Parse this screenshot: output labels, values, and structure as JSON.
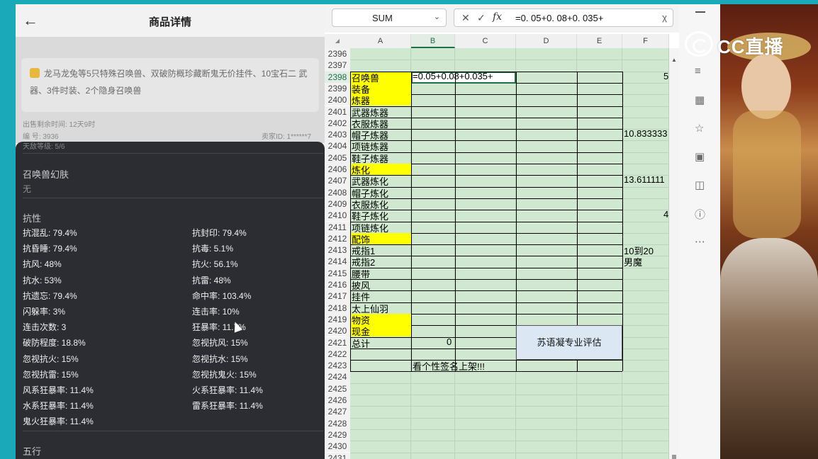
{
  "phone": {
    "title": "商品详情",
    "back_icon": "arrow-left-icon",
    "notice": "龙马龙兔等5只特殊召唤兽、双破防概珍藏断鬼无价挂件、10宝石二 武器、3件时装、2个隐身召唤兽",
    "listed_time": "出售剩余时间: 12天9时",
    "serial": "编 号: 3936",
    "seller_id": "卖家ID: 1******7",
    "cut_text": "天敌等级: 5/6",
    "skin_title": "召唤兽幻肤",
    "skin_value": "无",
    "resist_title": "抗性",
    "resist_left": [
      "抗混乱: 79.4%",
      "抗昏睡: 79.4%",
      "抗风: 48%",
      "抗水: 53%",
      "抗遗忘: 79.4%",
      "闪躲率: 3%",
      "连击次数: 3",
      "破防程度: 18.8%",
      "忽视抗火: 15%",
      "忽视抗雷: 15%",
      "风系狂暴率: 11.4%",
      "水系狂暴率: 11.4%",
      "鬼火狂暴率: 11.4%"
    ],
    "resist_right": [
      "抗封印: 79.4%",
      "抗毒: 5.1%",
      "抗火: 56.1%",
      "抗雷: 48%",
      "命中率: 103.4%",
      "连击率: 10%",
      "狂暴率: 11.7%",
      "忽视抗风: 15%",
      "忽视抗水: 15%",
      "忽视抗鬼火: 15%",
      "火系狂暴率: 11.4%",
      "雷系狂暴率: 11.4%"
    ],
    "wuxing_title": "五行"
  },
  "excel": {
    "name_box": "SUM",
    "cancel_icon": "x-icon",
    "confirm_icon": "check-icon",
    "fx_label": "fx",
    "formula": "=0. 05+0. 08+0. 035+",
    "columns": [
      "A",
      "B",
      "C",
      "D",
      "E",
      "F"
    ],
    "rows": [
      {
        "n": "2396",
        "a": "",
        "b": "",
        "f": ""
      },
      {
        "n": "2397",
        "a": "",
        "b": "",
        "f": ""
      },
      {
        "n": "2398",
        "a": "召唤兽",
        "b": "=0.05+0.08+0.035+",
        "f": "5"
      },
      {
        "n": "2399",
        "a": "装备",
        "b": "",
        "f": ""
      },
      {
        "n": "2400",
        "a": "炼器",
        "b": "",
        "f": ""
      },
      {
        "n": "2401",
        "a": "武器炼器",
        "b": "",
        "f": ""
      },
      {
        "n": "2402",
        "a": "衣服炼器",
        "b": "",
        "f": ""
      },
      {
        "n": "2403",
        "a": "帽子炼器",
        "b": "",
        "f": "10.833333"
      },
      {
        "n": "2404",
        "a": "项链炼器",
        "b": "",
        "f": ""
      },
      {
        "n": "2405",
        "a": "鞋子炼器",
        "b": "",
        "f": ""
      },
      {
        "n": "2406",
        "a": "炼化",
        "b": "",
        "f": ""
      },
      {
        "n": "2407",
        "a": "武器炼化",
        "b": "",
        "f": "13.611111"
      },
      {
        "n": "2408",
        "a": "帽子炼化",
        "b": "",
        "f": ""
      },
      {
        "n": "2409",
        "a": "衣服炼化",
        "b": "",
        "f": ""
      },
      {
        "n": "2410",
        "a": "鞋子炼化",
        "b": "",
        "f": "4"
      },
      {
        "n": "2411",
        "a": "项链炼化",
        "b": "",
        "f": ""
      },
      {
        "n": "2412",
        "a": "配饰",
        "b": "",
        "f": ""
      },
      {
        "n": "2413",
        "a": "戒指1",
        "b": "",
        "f": "10到20"
      },
      {
        "n": "2414",
        "a": "戒指2",
        "b": "",
        "f": "男魔"
      },
      {
        "n": "2415",
        "a": "腰带",
        "b": "",
        "f": ""
      },
      {
        "n": "2416",
        "a": "披风",
        "b": "",
        "f": ""
      },
      {
        "n": "2417",
        "a": "挂件",
        "b": "",
        "f": ""
      },
      {
        "n": "2418",
        "a": "太上仙羽",
        "b": "",
        "f": ""
      },
      {
        "n": "2419",
        "a": "物资",
        "b": "",
        "f": ""
      },
      {
        "n": "2420",
        "a": "现金",
        "b": "",
        "f": ""
      },
      {
        "n": "2421",
        "a": "总计",
        "b": "0",
        "f": ""
      },
      {
        "n": "2422",
        "a": "",
        "b": "",
        "f": ""
      },
      {
        "n": "2423",
        "a": "",
        "b": "看个性签名上架!!!",
        "f": ""
      },
      {
        "n": "2424",
        "a": "",
        "b": "",
        "f": ""
      },
      {
        "n": "2425",
        "a": "",
        "b": "",
        "f": ""
      },
      {
        "n": "2426",
        "a": "",
        "b": "",
        "f": ""
      },
      {
        "n": "2427",
        "a": "",
        "b": "",
        "f": ""
      },
      {
        "n": "2428",
        "a": "",
        "b": "",
        "f": ""
      },
      {
        "n": "2429",
        "a": "",
        "b": "",
        "f": ""
      },
      {
        "n": "2430",
        "a": "",
        "b": "",
        "f": ""
      },
      {
        "n": "2431",
        "a": "",
        "b": "",
        "f": ""
      }
    ],
    "yellow_rows": [
      "2398",
      "2399",
      "2400",
      "2406",
      "2412",
      "2419",
      "2420"
    ],
    "eval_box": "苏语凝专业评估"
  },
  "tools": {
    "icons": [
      "minimize-icon",
      "sliders-icon",
      "table-icon",
      "star-icon",
      "chart-icon",
      "search-doc-icon",
      "help-icon",
      "more-icon"
    ]
  },
  "watermark": {
    "text": "CC直播"
  },
  "colors": {
    "sheet_bg": "#cfe8cf",
    "highlight": "#ffff00",
    "accent": "#1e7145",
    "dark_panel": "#2c2d33"
  }
}
